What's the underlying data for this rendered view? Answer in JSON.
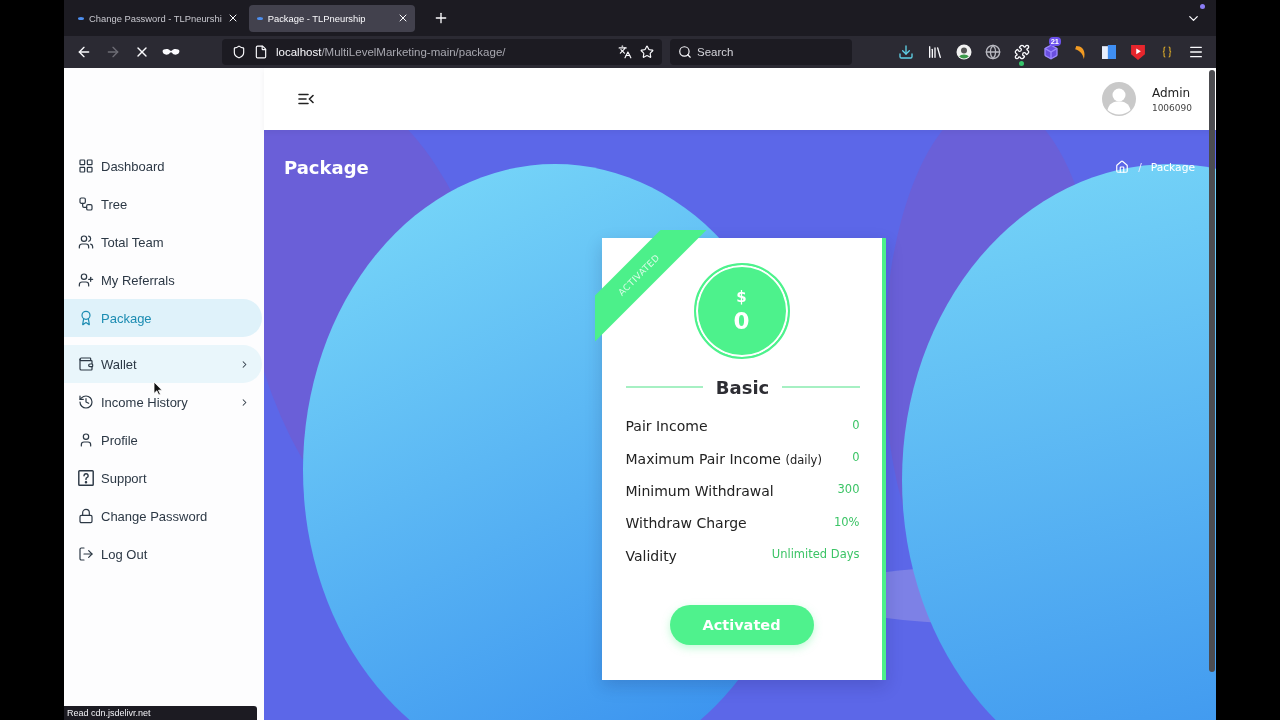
{
  "browser": {
    "tabs": [
      {
        "title": "Change Password - TLPneurshi",
        "selected": false
      },
      {
        "title": "Package - TLPneurship",
        "selected": true
      }
    ],
    "forward_disabled": true,
    "url": {
      "host": "localhost",
      "path": "/MultiLevelMarketing-main/package/"
    },
    "search": {
      "placeholder": "Search"
    },
    "extension_badge": "21",
    "status_text": "Read cdn.jsdelivr.net"
  },
  "sidebar": {
    "items": [
      {
        "label": "Dashboard",
        "selected": false,
        "hovered": false,
        "expandable": false
      },
      {
        "label": "Tree",
        "selected": false,
        "hovered": false,
        "expandable": false
      },
      {
        "label": "Total Team",
        "selected": false,
        "hovered": false,
        "expandable": false
      },
      {
        "label": "My Referrals",
        "selected": false,
        "hovered": false,
        "expandable": false
      },
      {
        "label": "Package",
        "selected": true,
        "hovered": false,
        "expandable": false
      },
      {
        "label": "Wallet",
        "selected": false,
        "hovered": true,
        "expandable": true
      },
      {
        "label": "Income History",
        "selected": false,
        "hovered": false,
        "expandable": true
      },
      {
        "label": "Profile",
        "selected": false,
        "hovered": false,
        "expandable": false
      },
      {
        "label": "Support",
        "selected": false,
        "hovered": false,
        "expandable": false
      },
      {
        "label": "Change Password",
        "selected": false,
        "hovered": false,
        "expandable": false
      },
      {
        "label": "Log Out",
        "selected": false,
        "hovered": false,
        "expandable": false
      }
    ]
  },
  "header": {
    "user": {
      "name": "Admin",
      "id": "1006090"
    }
  },
  "page": {
    "title": "Package",
    "breadcrumb": {
      "separator": "/",
      "items": [
        "Package"
      ]
    }
  },
  "package_card": {
    "ribbon": "ACTIVATED",
    "currency": "$",
    "price": "0",
    "name": "Basic",
    "features": [
      {
        "label": "Pair Income",
        "value": "0"
      },
      {
        "label": "Maximum Pair Income",
        "note": "(daily)",
        "value": "0"
      },
      {
        "label": "Minimum Withdrawal",
        "value": "300"
      },
      {
        "label": "Withdraw Charge",
        "value": "10%"
      },
      {
        "label": "Validity",
        "value": "Unlimited Days"
      }
    ],
    "button": {
      "label": "Activated"
    }
  }
}
